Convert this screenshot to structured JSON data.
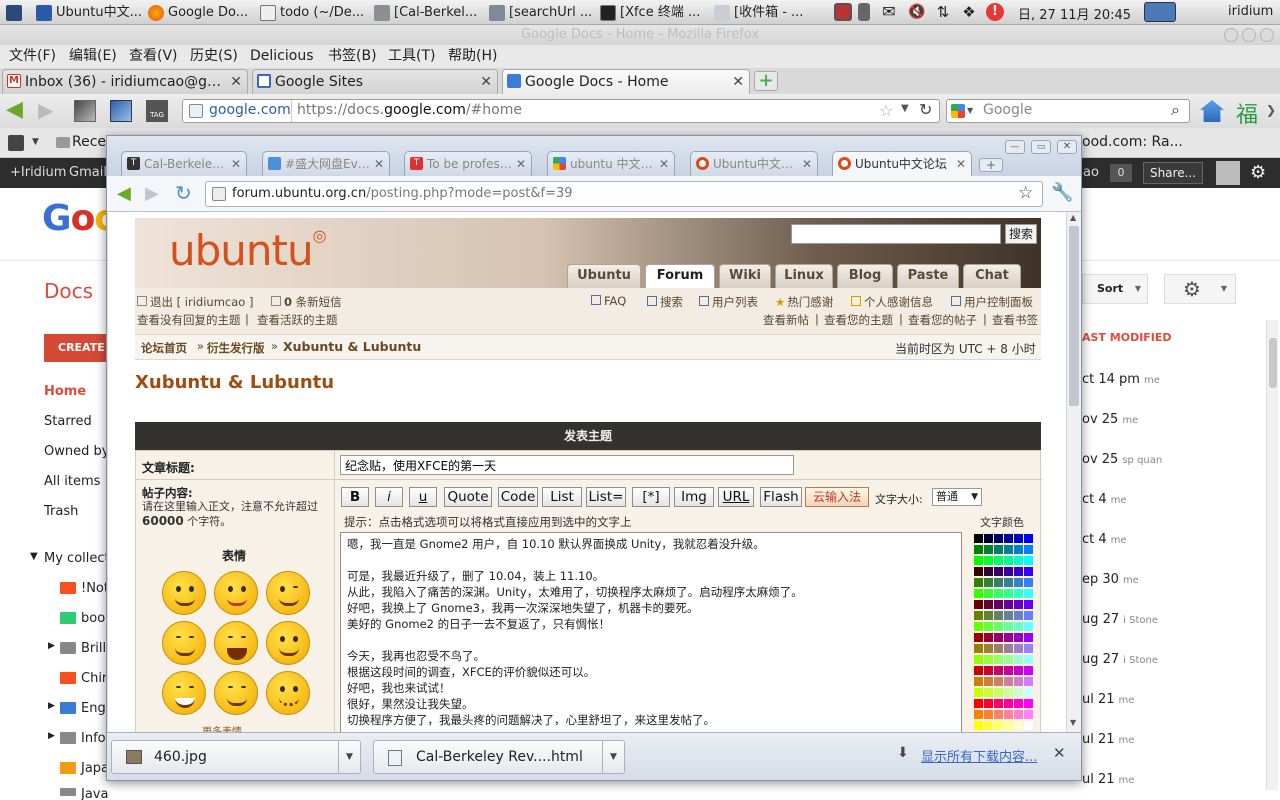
{
  "panel": {
    "tasks": [
      {
        "label": "Ubuntu中文...",
        "icon": "ubuntu-icon"
      },
      {
        "label": "Google Do...",
        "icon": "firefox-icon"
      },
      {
        "label": "todo (~/De...",
        "icon": "text-editor-icon"
      },
      {
        "label": "[Cal-Berkel...",
        "icon": "folder-icon"
      },
      {
        "label": "[searchUrl ...",
        "icon": "package-icon"
      },
      {
        "label": "[Xfce 终端 ...",
        "icon": "terminal-icon"
      },
      {
        "label": "[收件箱 - ...",
        "icon": "mail-icon"
      }
    ],
    "clock": "日, 27 11月  20:45",
    "user": "iridium"
  },
  "firefox": {
    "title": "Google Docs - Home - Mozilla Firefox",
    "menu": [
      "文件(F)",
      "编辑(E)",
      "查看(V)",
      "历史(S)",
      "Delicious",
      "书签(B)",
      "工具(T)",
      "帮助(H)"
    ],
    "tabs": [
      {
        "label": "Inbox (36) - iridiumcao@gmai...",
        "icon": "gmail-icon",
        "color": "#d93025"
      },
      {
        "label": "Google Sites",
        "icon": "sites-icon",
        "color": "#3a66c6"
      },
      {
        "label": "Google Docs - Home",
        "icon": "docs-icon",
        "color": "#3a7bd5",
        "active": true
      }
    ],
    "url_domain": "google.com",
    "url_prefix": "https://docs.",
    "url_host": "google.com",
    "url_path": "/#home",
    "search_placeholder": "Google",
    "bookmark_first": "Rece",
    "bookmark_right": "ood.com: Ra..."
  },
  "gbar": {
    "items": [
      "+Iridium",
      "Gmail"
    ],
    "right_text": "ao",
    "count": "0",
    "share": "Share..."
  },
  "docs": {
    "logo": "Goo",
    "section_title": "Docs",
    "create_label": "CREATE",
    "sort_label": "Sort",
    "last_modified_header": "AST MODIFIED",
    "nav": [
      "Home",
      "Starred",
      "Owned by",
      "All items",
      "Trash"
    ],
    "collections_label": "My collect",
    "collections": [
      {
        "label": "!Not",
        "color": "#f4511e"
      },
      {
        "label": "bool",
        "color": "#2ecc71"
      },
      {
        "label": "Brill",
        "color": "#888888"
      },
      {
        "label": "Chir",
        "color": "#f4511e"
      },
      {
        "label": "Eng",
        "color": "#3a7bd5"
      },
      {
        "label": "Info",
        "color": "#888888"
      },
      {
        "label": "Japa",
        "color": "#f39c12"
      },
      {
        "label": "Java",
        "color": "#888888"
      }
    ],
    "dates": [
      {
        "date": "ct 14 pm",
        "who": "me"
      },
      {
        "date": "ov 25",
        "who": "me"
      },
      {
        "date": "ov 25",
        "who": "sp quan"
      },
      {
        "date": "ct 4",
        "who": "me"
      },
      {
        "date": "ct 4",
        "who": "me"
      },
      {
        "date": "ep 30",
        "who": "me"
      },
      {
        "date": "ug 27",
        "who": "i Stone"
      },
      {
        "date": "ug 27",
        "who": "i Stone"
      },
      {
        "date": "ul 21",
        "who": "me"
      },
      {
        "date": "ul 21",
        "who": "me"
      },
      {
        "date": "ul 21",
        "who": "me"
      }
    ]
  },
  "chrome": {
    "tabs": [
      {
        "label": "Cal-Berkeley Rev",
        "color": "#333333"
      },
      {
        "label": "#盛大网盘EverBo",
        "color": "#4a8fd8"
      },
      {
        "label": "To be professiona",
        "color": "#e03030"
      },
      {
        "label": "ubuntu 中文论坛",
        "color": "#4285f4"
      },
      {
        "label": "Ubuntu中文论坛",
        "color": "#dd4814"
      },
      {
        "label": "Ubuntu中文论坛",
        "color": "#dd4814",
        "active": true
      }
    ],
    "url_host": "forum.ubuntu.org.cn",
    "url_path": "/posting.php?mode=post&f=39",
    "downloads": [
      {
        "label": "460.jpg"
      },
      {
        "label": "Cal-Berkeley Rev....html"
      }
    ],
    "show_all_downloads": "显示所有下载内容..."
  },
  "forum": {
    "logo": "ubuntu",
    "search_button": "搜索",
    "nav": [
      "Ubuntu",
      "Forum",
      "Wiki",
      "Linux",
      "Blog",
      "Paste",
      "Chat"
    ],
    "logout": "退出 [ iridiumcao ]",
    "msg_count": "0",
    "msg_label": "条新短信",
    "links_right_1": [
      "FAQ",
      "搜索",
      "用户列表",
      "热门感谢",
      "个人感谢信息",
      "用户控制面板"
    ],
    "link_left_2a": "查看没有回复的主题",
    "link_left_2b": "查看活跃的主题",
    "links_right_2": [
      "查看新帖",
      "查看您的主题",
      "查看您的帖子",
      "查看书签"
    ],
    "crumb": [
      "论坛首页",
      "衍生发行版",
      "Xubuntu & Lubuntu"
    ],
    "timezone": "当前时区为 UTC + 8 小时",
    "forum_title": "Xubuntu & Lubuntu",
    "form_header": "发表主题",
    "subject_label": "文章标题:",
    "subject_value": "纪念贴，使用XFCE的第一天",
    "content_label": "帖子内容:",
    "content_hint": "请在这里输入正文，注意不允许超过",
    "content_limit": "60000",
    "content_hint_end": "个字符。",
    "emotes_label": "表情",
    "more_emotes": "更多表情",
    "buttons": [
      "B",
      "i",
      "u",
      "Quote",
      "Code",
      "List",
      "List=",
      "[*]",
      "Img",
      "URL",
      "Flash"
    ],
    "cloud_input": "云输入法",
    "font_size_label": "文字大小:",
    "font_size_value": "普通",
    "hint": "提示：点击格式选项可以将格式直接应用到选中的文字上",
    "color_label": "文字颜色",
    "post_lines": [
      "嗯，我一直是 Gnome2 用户，自 10.10 默认界面换成 Unity，我就忍着没升级。",
      "",
      "可是，我最近升级了，删了 10.04，装上 11.10。",
      "从此，我陷入了痛苦的深渊。Unity，太难用了，切换程序太麻烦了。启动程序太麻烦了。",
      "好吧，我换上了 Gnome3，我再一次深深地失望了，机器卡的要死。",
      "美好的 Gnome2 的日子一去不复返了，只有惆怅！",
      "",
      "今天，我再也忍受不鸟了。",
      "根据这段时间的调查，XFCE的评价貌似还可以。",
      "好吧，我也来试试！",
      "很好，果然没让我失望。",
      "切换程序方便了，我最头疼的问题解决了，心里舒坦了，来这里发帖了。"
    ]
  }
}
